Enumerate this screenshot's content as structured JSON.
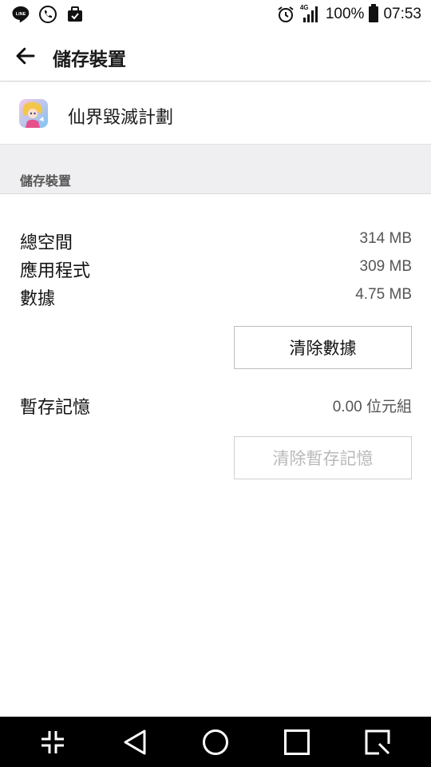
{
  "status_bar": {
    "left_icons": [
      "line-app-icon",
      "phone-call-icon",
      "briefcase-check-icon"
    ],
    "network_label": "4G",
    "battery_percent": "100%",
    "time": "07:53"
  },
  "app_bar": {
    "title": "儲存裝置"
  },
  "app": {
    "name": "仙界毀滅計劃"
  },
  "section": {
    "header": "儲存裝置"
  },
  "storage": {
    "total_label": "總空間",
    "total_value": "314 MB",
    "app_label": "應用程式",
    "app_value": "309 MB",
    "data_label": "數據",
    "data_value": "4.75 MB",
    "clear_data_button": "清除數據",
    "cache_label": "暫存記憶",
    "cache_value": "0.00 位元組",
    "clear_cache_button": "清除暫存記憶"
  },
  "nav_bar": {
    "buttons": [
      "dual-window-icon",
      "back-icon",
      "home-icon",
      "recents-icon",
      "capture-plus-icon"
    ]
  }
}
